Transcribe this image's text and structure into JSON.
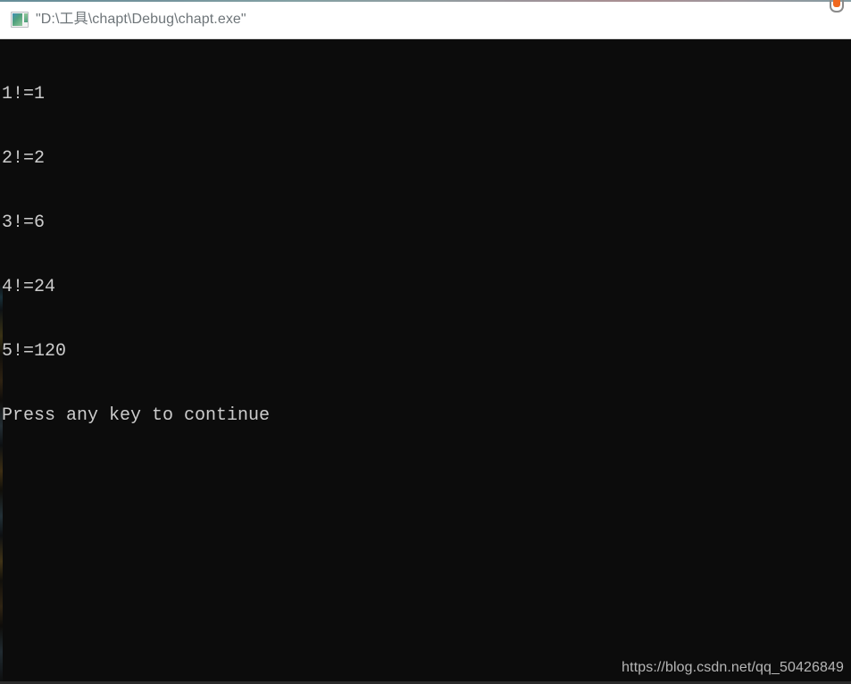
{
  "window": {
    "title": "\"D:\\工具\\chapt\\Debug\\chapt.exe\"",
    "icon_name": "console-app-icon",
    "title_bar_background": "#ffffff",
    "title_text_color": "#6e7579"
  },
  "corner": {
    "glyph_name": "orange-u-glyph",
    "accent_color": "#f0681f",
    "outline_color": "#8a8a8a"
  },
  "console": {
    "background": "#0c0c0c",
    "text_color": "#cccccc",
    "lines": [
      "1!=1",
      "2!=2",
      "3!=6",
      "4!=24",
      "5!=120",
      "Press any key to continue"
    ]
  },
  "watermark": {
    "text": "https://blog.csdn.net/qq_50426849",
    "color": "#b6b6b6"
  }
}
